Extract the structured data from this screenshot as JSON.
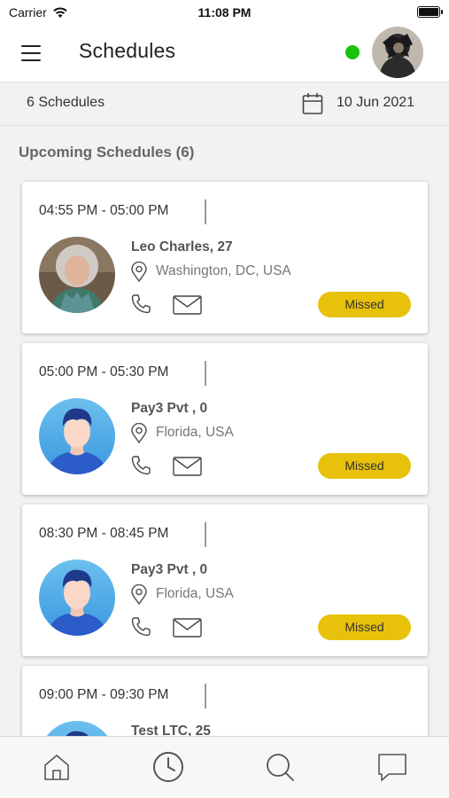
{
  "status_bar": {
    "carrier": "Carrier",
    "time": "11:08 PM"
  },
  "header": {
    "title": "Schedules"
  },
  "summary": {
    "count_label": "6 Schedules",
    "date": "10 Jun 2021"
  },
  "section": {
    "title": "Upcoming Schedules (6)"
  },
  "schedules": [
    {
      "time_range": "04:55 PM - 05:00 PM",
      "name": "Leo Charles, 27",
      "location": "Washington, DC, USA",
      "status": "Missed",
      "avatar": "photo"
    },
    {
      "time_range": "05:00 PM - 05:30 PM",
      "name": "Pay3 Pvt , 0",
      "location": "Florida, USA",
      "status": "Missed",
      "avatar": "placeholder"
    },
    {
      "time_range": "08:30 PM - 08:45 PM",
      "name": "Pay3 Pvt , 0",
      "location": "Florida, USA",
      "status": "Missed",
      "avatar": "placeholder"
    },
    {
      "time_range": "09:00 PM - 09:30 PM",
      "name": "Test LTC, 25",
      "location": "",
      "status": "",
      "avatar": "placeholder"
    }
  ],
  "colors": {
    "accent": "#e8c10a",
    "online": "#19c20c",
    "avatar_bg": "#4aa8e8"
  },
  "tabs": [
    {
      "icon": "home-icon"
    },
    {
      "icon": "clock-icon"
    },
    {
      "icon": "search-icon"
    },
    {
      "icon": "chat-icon"
    }
  ]
}
